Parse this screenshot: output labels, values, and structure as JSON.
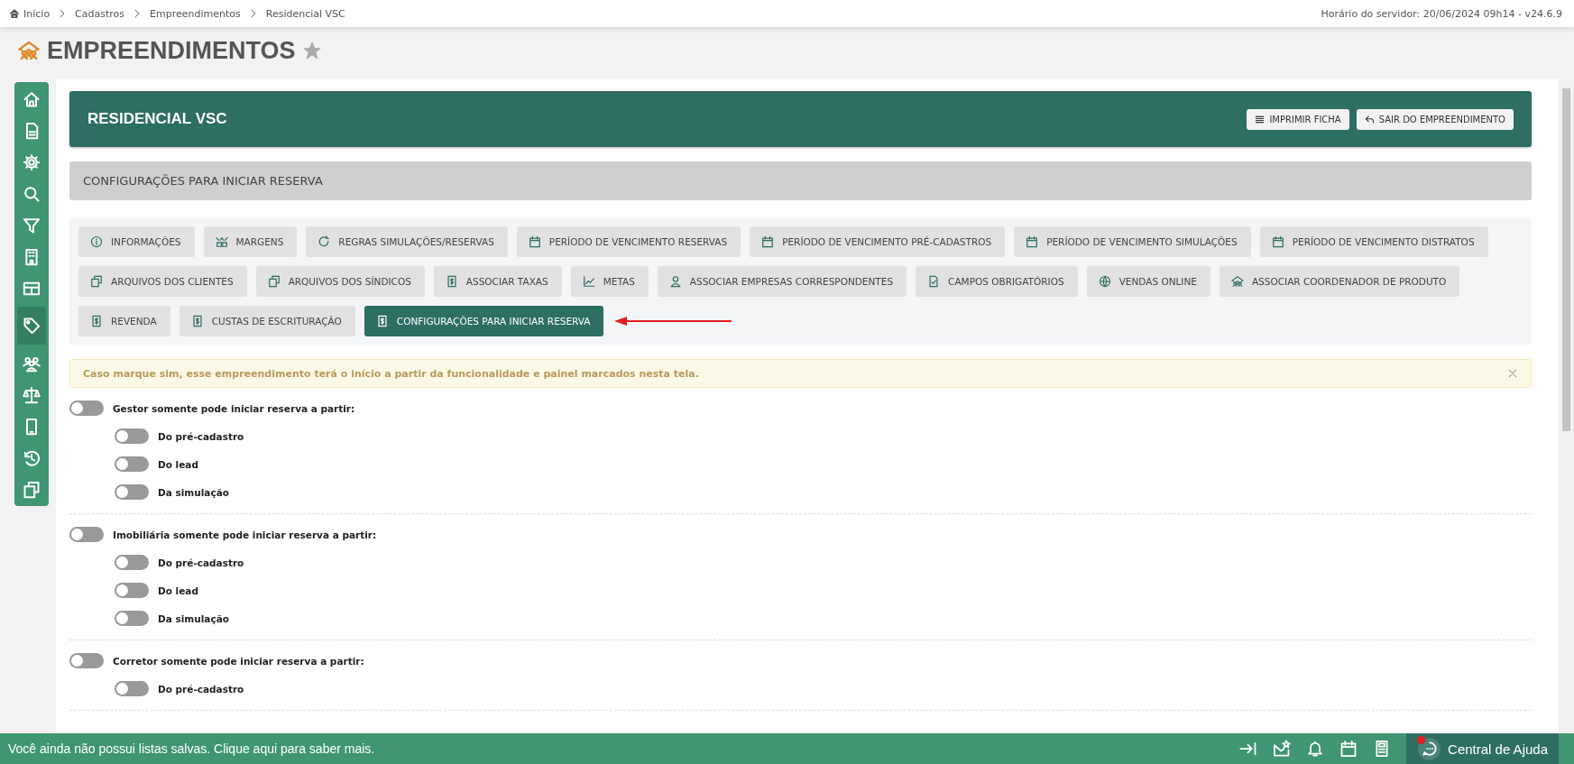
{
  "breadcrumb": [
    "Início",
    "Cadastros",
    "Empreendimentos",
    "Residencial VSC"
  ],
  "server_time": "Horário do servidor: 20/06/2024 09h14 - v24.6.9",
  "page_title": "EMPREENDIMENTOS",
  "sidebar": {
    "items": [
      {
        "selected": false
      },
      {
        "selected": false
      },
      {
        "selected": false
      },
      {
        "selected": false
      },
      {
        "selected": false
      },
      {
        "selected": false
      },
      {
        "selected": false
      },
      {
        "selected": true
      },
      {
        "selected": false
      },
      {
        "selected": false
      },
      {
        "selected": false
      },
      {
        "selected": false
      },
      {
        "selected": false
      }
    ]
  },
  "header": {
    "title": "RESIDENCIAL VSC",
    "buttons": [
      "IMPRIMIR FICHA",
      "SAIR DO EMPREENDIMENTO"
    ]
  },
  "section_title": "CONFIGURAÇÕES PARA INICIAR RESERVA",
  "tabs": [
    {
      "label": "INFORMAÇÕES",
      "selected": false
    },
    {
      "label": "MARGENS",
      "selected": false
    },
    {
      "label": "REGRAS SIMULAÇÕES/RESERVAS",
      "selected": false
    },
    {
      "label": "PERÍODO DE VENCIMENTO RESERVAS",
      "selected": false
    },
    {
      "label": "PERÍODO DE VENCIMENTO PRÉ-CADASTROS",
      "selected": false
    },
    {
      "label": "PERÍODO DE VENCIMENTO SIMULAÇÕES",
      "selected": false
    },
    {
      "label": "PERÍODO DE VENCIMENTO DISTRATOS",
      "selected": false
    },
    {
      "label": "ARQUIVOS DOS CLIENTES",
      "selected": false
    },
    {
      "label": "ARQUIVOS DOS SÍNDICOS",
      "selected": false
    },
    {
      "label": "ASSOCIAR TAXAS",
      "selected": false
    },
    {
      "label": "METAS",
      "selected": false
    },
    {
      "label": "ASSOCIAR EMPRESAS CORRESPONDENTES",
      "selected": false
    },
    {
      "label": "CAMPOS OBRIGATÓRIOS",
      "selected": false
    },
    {
      "label": "VENDAS ONLINE",
      "selected": false
    },
    {
      "label": "ASSOCIAR COORDENADOR DE PRODUTO",
      "selected": false
    },
    {
      "label": "REVENDA",
      "selected": false
    },
    {
      "label": "CUSTAS DE ESCRITURAÇÃO",
      "selected": false
    },
    {
      "label": "CONFIGURAÇÕES PARA INICIAR RESERVA",
      "selected": true
    }
  ],
  "alert": {
    "text": "Caso marque sim, esse empreendimento terá o início a partir da funcionalidade e painel marcados nesta tela."
  },
  "toggle_groups": [
    {
      "label": "Gestor somente pode iniciar reserva a partir:",
      "on": false,
      "options": [
        {
          "label": "Do pré-cadastro",
          "on": false
        },
        {
          "label": "Do lead",
          "on": false
        },
        {
          "label": "Da simulação",
          "on": false
        }
      ]
    },
    {
      "label": "Imobiliária somente pode iniciar reserva a partir:",
      "on": false,
      "options": [
        {
          "label": "Do pré-cadastro",
          "on": false
        },
        {
          "label": "Do lead",
          "on": false
        },
        {
          "label": "Da simulação",
          "on": false
        }
      ]
    },
    {
      "label": "Corretor somente pode iniciar reserva a partir:",
      "on": false,
      "options": [
        {
          "label": "Do pré-cadastro",
          "on": false
        }
      ]
    }
  ],
  "status_bar": {
    "message": "Você ainda não possui listas salvas. Clique aqui para saber mais.",
    "help": "Central de Ajuda"
  }
}
